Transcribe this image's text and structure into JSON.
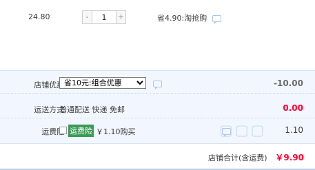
{
  "item": {
    "price": "24.80",
    "quantity": "1",
    "minus": "-",
    "plus": "+",
    "saving": "省4.90:淘抢购"
  },
  "discount": {
    "label": "店铺优惠:",
    "selected": "省10元:组合优惠",
    "value": "-10.00"
  },
  "shipping": {
    "label": "运送方式:",
    "method": "普通配送 快递 免邮",
    "value": "0.00"
  },
  "insurance": {
    "label": "运费险:",
    "tag": "运费险",
    "text": "￥1.10购买",
    "value": "1.10"
  },
  "total": {
    "label": "店铺合计(含运费)",
    "value": "￥9.90"
  },
  "colors": {
    "accent_red": "#ff0036",
    "summary_bg": "#f2f7ff",
    "tag_green": "#3a9b57"
  }
}
